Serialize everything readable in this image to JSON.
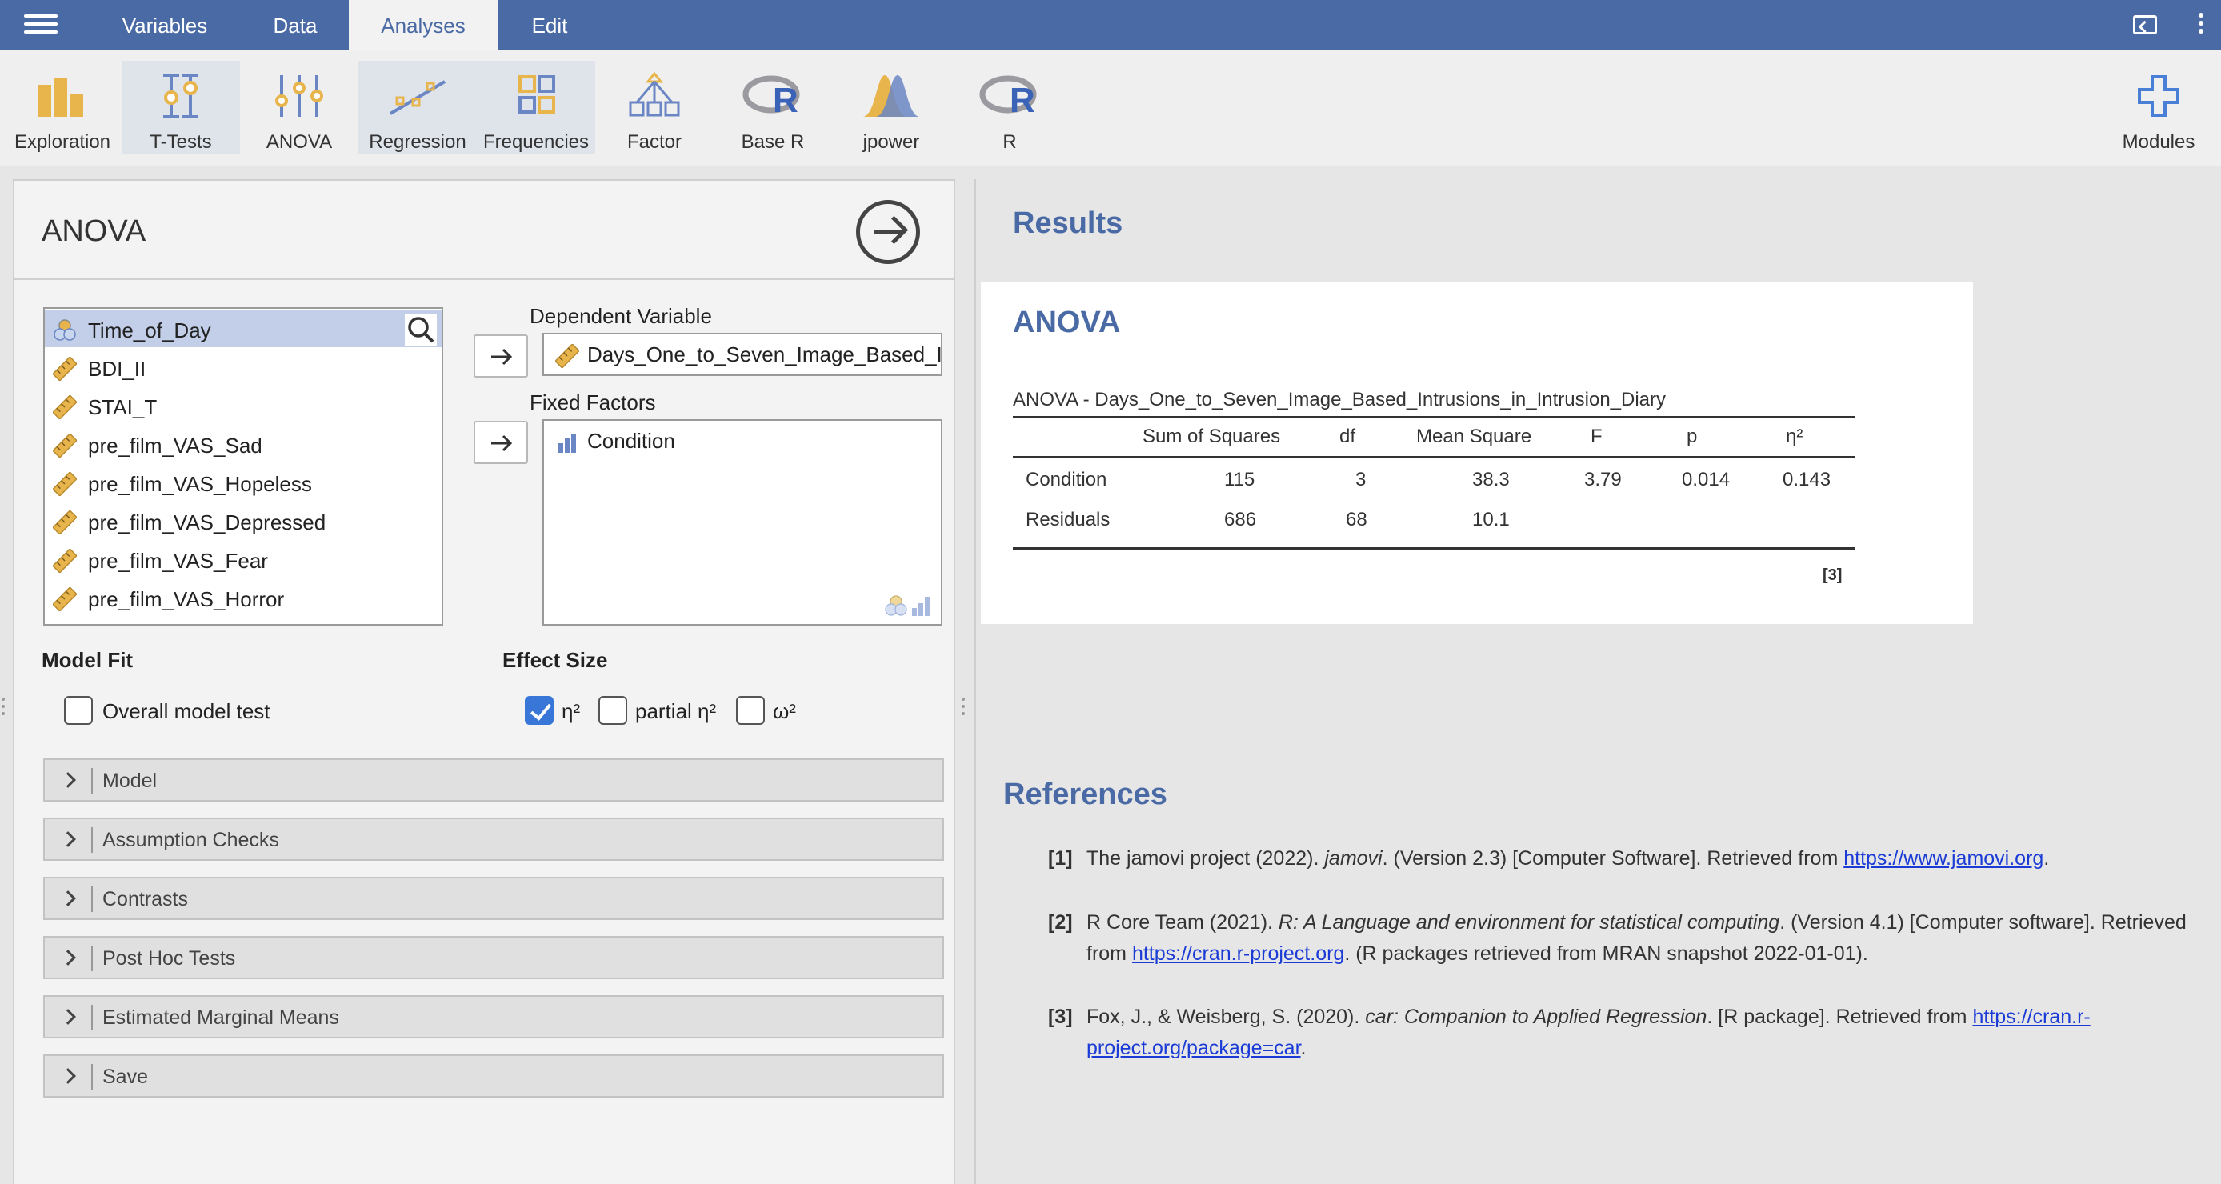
{
  "nav": {
    "tabs": [
      {
        "label": "Variables",
        "active": false
      },
      {
        "label": "Data",
        "active": false
      },
      {
        "label": "Analyses",
        "active": true
      },
      {
        "label": "Edit",
        "active": false
      }
    ]
  },
  "ribbon": {
    "items": [
      {
        "label": "Exploration",
        "icon": "exploration-icon"
      },
      {
        "label": "T-Tests",
        "icon": "t-tests-icon"
      },
      {
        "label": "ANOVA",
        "icon": "anova-icon"
      },
      {
        "label": "Regression",
        "icon": "regression-icon"
      },
      {
        "label": "Frequencies",
        "icon": "frequencies-icon"
      },
      {
        "label": "Factor",
        "icon": "factor-icon"
      },
      {
        "label": "Base R",
        "icon": "base-r-icon"
      },
      {
        "label": "jpower",
        "icon": "jpower-icon"
      },
      {
        "label": "R",
        "icon": "r-icon"
      }
    ],
    "modules_label": "Modules"
  },
  "options": {
    "title": "ANOVA",
    "variables": [
      {
        "name": "Time_of_Day",
        "type": "nominal",
        "selected": true
      },
      {
        "name": "BDI_II",
        "type": "continuous"
      },
      {
        "name": "STAI_T",
        "type": "continuous"
      },
      {
        "name": "pre_film_VAS_Sad",
        "type": "continuous"
      },
      {
        "name": "pre_film_VAS_Hopeless",
        "type": "continuous"
      },
      {
        "name": "pre_film_VAS_Depressed",
        "type": "continuous"
      },
      {
        "name": "pre_film_VAS_Fear",
        "type": "continuous"
      },
      {
        "name": "pre_film_VAS_Horror",
        "type": "continuous"
      }
    ],
    "dependent_label": "Dependent Variable",
    "dependent_value": "Days_One_to_Seven_Image_Based_Intrusions_in_Intrusion_Diary",
    "factors_label": "Fixed Factors",
    "factors": [
      "Condition"
    ],
    "model_fit_label": "Model Fit",
    "overall_model_test_label": "Overall model test",
    "overall_model_test_checked": false,
    "effect_size_label": "Effect Size",
    "effect_sizes": [
      {
        "label": "η²",
        "checked": true
      },
      {
        "label": "partial η²",
        "checked": false
      },
      {
        "label": "ω²",
        "checked": false
      }
    ],
    "sections": [
      "Model",
      "Assumption Checks",
      "Contrasts",
      "Post Hoc Tests",
      "Estimated Marginal Means",
      "Save"
    ]
  },
  "results": {
    "heading": "Results",
    "analysis_title": "ANOVA",
    "table_caption": "ANOVA - Days_One_to_Seven_Image_Based_Intrusions_in_Intrusion_Diary",
    "columns": [
      "",
      "Sum of Squares",
      "df",
      "Mean Square",
      "F",
      "p",
      "η²"
    ],
    "rows": [
      [
        "Condition",
        "115",
        "3",
        "38.3",
        "3.79",
        "0.014",
        "0.143"
      ],
      [
        "Residuals",
        "686",
        "68",
        "10.1",
        "",
        "",
        ""
      ]
    ],
    "footnote": "[3]"
  },
  "references": {
    "heading": "References",
    "items": [
      {
        "num": "[1]",
        "before": "The jamovi project (2022). ",
        "italic": "jamovi",
        "after": ". (Version 2.3) [Computer Software]. Retrieved from ",
        "link": "https://www.jamovi.org",
        "tail": "."
      },
      {
        "num": "[2]",
        "before": "R Core Team (2021). ",
        "italic": "R: A Language and environment for statistical computing",
        "after": ". (Version 4.1) [Computer software]. Retrieved from ",
        "link": "https://cran.r-project.org",
        "tail": ". (R packages retrieved from MRAN snapshot 2022-01-01)."
      },
      {
        "num": "[3]",
        "before": "Fox, J., & Weisberg, S. (2020). ",
        "italic": "car: Companion to Applied Regression",
        "after": ". [R package]. Retrieved from ",
        "link": "https://cran.r-project.org/package=car",
        "tail": "."
      }
    ]
  },
  "colors": {
    "accent": "#4a6aa5",
    "check": "#3877d8",
    "link": "#1a3bd6",
    "icon_gold": "#e8b44c"
  }
}
